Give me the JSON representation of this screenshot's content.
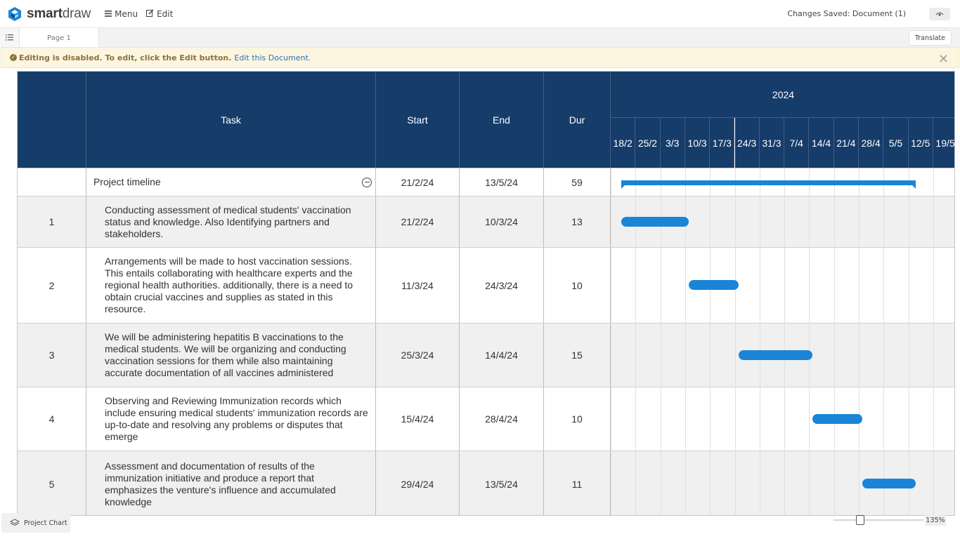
{
  "app": {
    "logo_bold": "smart",
    "logo_thin": "draw",
    "menu_label": "Menu",
    "edit_label": "Edit",
    "status": "Changes Saved: Document (1)",
    "page_tab": "Page 1",
    "translate_label": "Translate"
  },
  "notice": {
    "message": "Editing is disabled. To edit, click the Edit button.",
    "link": "Edit this Document",
    "trailing": "."
  },
  "gantt": {
    "headers": {
      "task": "Task",
      "start": "Start",
      "end": "End",
      "dur": "Dur",
      "year": "2024"
    },
    "weeks": [
      "18/2",
      "25/2",
      "3/3",
      "10/3",
      "17/3",
      "24/3",
      "31/3",
      "7/4",
      "14/4",
      "21/4",
      "28/4",
      "5/5",
      "12/5",
      "19/5"
    ],
    "summary": {
      "task": "Project timeline",
      "start": "21/2/24",
      "end": "13/5/24",
      "dur": "59"
    },
    "rows": [
      {
        "num": "1",
        "task": "Conducting assessment of medical students' vaccination status and knowledge. Also Identifying partners and stakeholders.",
        "start": "21/2/24",
        "end": "10/3/24",
        "dur": "13"
      },
      {
        "num": "2",
        "task": "Arrangements will be made to host vaccination sessions. This entails collaborating with healthcare experts and the regional health authorities. additionally, there is a need to obtain crucial vaccines and supplies as stated in this resource.",
        "start": "11/3/24",
        "end": "24/3/24",
        "dur": "10"
      },
      {
        "num": "3",
        "task": "We will be administering hepatitis B vaccinations to the medical students. We will be organizing and conducting vaccination sessions for them while also maintaining accurate documentation of all vaccines administered",
        "start": "25/3/24",
        "end": "14/4/24",
        "dur": "15"
      },
      {
        "num": "4",
        "task": "Observing and Reviewing Immunization records which include ensuring medical students' immunization records are up-to-date and resolving any problems or disputes that emerge",
        "start": "15/4/24",
        "end": "28/4/24",
        "dur": "10"
      },
      {
        "num": "5",
        "task": "Assessment and documentation of results of the immunization initiative and produce a report that emphasizes the venture's influence and accumulated knowledge",
        "start": "29/4/24",
        "end": "13/5/24",
        "dur": "11"
      }
    ]
  },
  "bottom": {
    "layer_label": "Project Chart",
    "zoom": "135%"
  },
  "colors": {
    "header_bg": "#163c6a",
    "bar": "#1a85d6",
    "notice_bg": "#fcf6e0"
  }
}
